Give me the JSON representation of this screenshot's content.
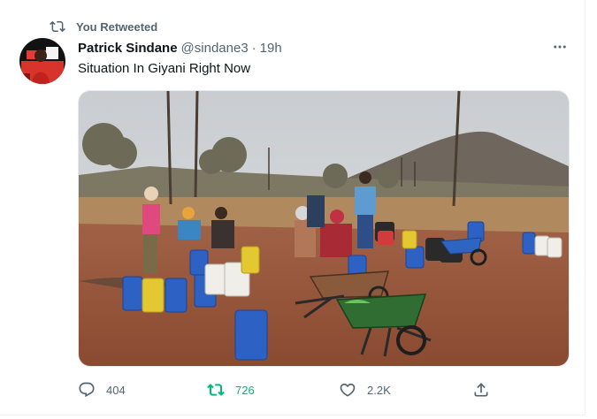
{
  "retweet_banner": {
    "text": "You Retweeted"
  },
  "tweet": {
    "author_name": "Patrick Sindane",
    "handle": "@sindane3",
    "separator": "·",
    "time": "19h",
    "text": "Situation In Giyani Right Now"
  },
  "actions": {
    "replies": "404",
    "retweets": "726",
    "likes": "2.2K"
  },
  "icons": {
    "retweet_banner": "retweet-icon",
    "more": "more-horizontal-icon",
    "reply": "reply-icon",
    "retweet": "retweet-icon",
    "like": "heart-icon",
    "share": "share-icon"
  },
  "colors": {
    "retweeted_green": "#00ba7c",
    "secondary_text": "#536471",
    "primary_text": "#0f1419"
  }
}
